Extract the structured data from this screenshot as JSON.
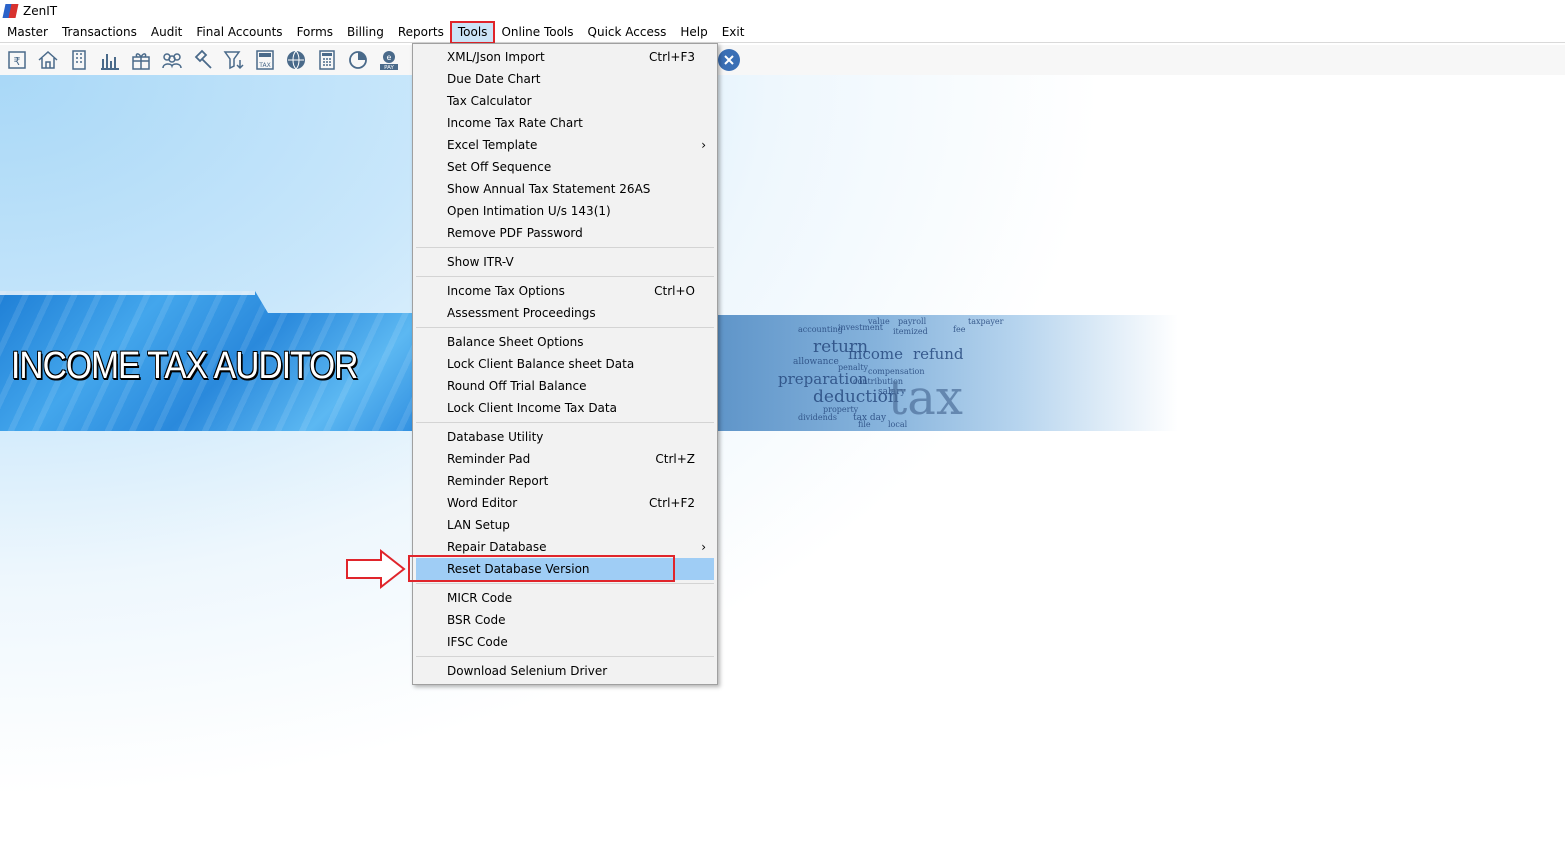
{
  "app": {
    "title": "ZenIT"
  },
  "menubar": [
    {
      "label": "Master"
    },
    {
      "label": "Transactions"
    },
    {
      "label": "Audit"
    },
    {
      "label": "Final Accounts"
    },
    {
      "label": "Forms"
    },
    {
      "label": "Billing"
    },
    {
      "label": "Reports"
    },
    {
      "label": "Tools",
      "active": true
    },
    {
      "label": "Online Tools"
    },
    {
      "label": "Quick Access"
    },
    {
      "label": "Help"
    },
    {
      "label": "Exit"
    }
  ],
  "toolbar": {
    "icons": [
      "rupee-document-icon",
      "home-icon",
      "building-icon",
      "bar-chart-icon",
      "gift-icon",
      "users-group-icon",
      "gavel-icon",
      "filter-down-icon",
      "tax-calculator-icon",
      "globe-icon",
      "calculator-icon",
      "pie-chart-icon",
      "epay-icon",
      "close-circle-icon"
    ],
    "tax_badge": "TAX",
    "pay_badge": "PAY"
  },
  "banner": {
    "title": "INCOME TAX AUDITOR",
    "words": [
      "value",
      "payroll",
      "taxpayer",
      "accounting",
      "investment",
      "itemized",
      "fee",
      "return",
      "income",
      "refund",
      "allowance",
      "penalty",
      "compensation",
      "preparation",
      "contribution",
      "deduction",
      "salary",
      "property",
      "tax day",
      "tax",
      "dividends",
      "file",
      "local"
    ]
  },
  "tools_menu": {
    "groups": [
      [
        {
          "label": "XML/Json Import",
          "shortcut": "Ctrl+F3"
        },
        {
          "label": "Due Date Chart"
        },
        {
          "label": "Tax Calculator"
        },
        {
          "label": "Income Tax Rate Chart"
        },
        {
          "label": "Excel Template",
          "submenu": true
        },
        {
          "label": "Set Off Sequence"
        },
        {
          "label": "Show Annual Tax Statement 26AS"
        },
        {
          "label": "Open Intimation U/s 143(1)"
        },
        {
          "label": "Remove PDF Password"
        }
      ],
      [
        {
          "label": "Show ITR-V"
        }
      ],
      [
        {
          "label": "Income Tax Options",
          "shortcut": "Ctrl+O"
        },
        {
          "label": "Assessment Proceedings"
        }
      ],
      [
        {
          "label": "Balance Sheet Options"
        },
        {
          "label": "Lock Client Balance sheet Data"
        },
        {
          "label": "Round Off Trial Balance"
        },
        {
          "label": "Lock Client Income Tax Data"
        }
      ],
      [
        {
          "label": "Database Utility"
        },
        {
          "label": "Reminder Pad",
          "shortcut": "Ctrl+Z"
        },
        {
          "label": "Reminder Report"
        },
        {
          "label": "Word Editor",
          "shortcut": "Ctrl+F2"
        },
        {
          "label": "LAN Setup"
        },
        {
          "label": "Repair Database",
          "submenu": true
        },
        {
          "label": "Reset Database Version",
          "highlighted": true
        }
      ],
      [
        {
          "label": "MICR Code"
        },
        {
          "label": "BSR Code"
        },
        {
          "label": "IFSC Code"
        }
      ],
      [
        {
          "label": "Download Selenium Driver"
        }
      ]
    ],
    "submenu_glyph": "›"
  },
  "colors": {
    "highlight": "#9fcdf5",
    "annotation": "#e0252b",
    "active_menu": "#cce4f7"
  }
}
